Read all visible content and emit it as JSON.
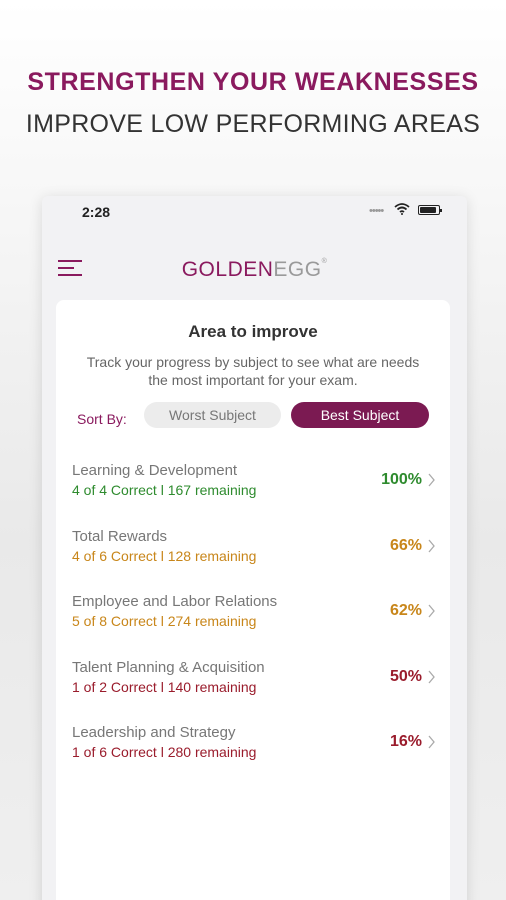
{
  "header": {
    "headline": "STRENGTHEN YOUR WEAKNESSES",
    "subheadline": "IMPROVE LOW PERFORMING AREAS"
  },
  "status_bar": {
    "time": "2:28"
  },
  "app": {
    "logo_golden": "GOLDEN",
    "logo_egg": "EGG",
    "logo_mark": "®"
  },
  "card": {
    "title": "Area to improve",
    "description": "Track your progress by subject to see what are needs the most important for your exam.",
    "sort_label": "Sort By:",
    "sort_worst": "Worst Subject",
    "sort_best": "Best Subject"
  },
  "subjects": [
    {
      "name": "Learning & Development",
      "stats": "4 of 4  Correct l 167 remaining",
      "percent": "100%",
      "color": "#2e8b2e"
    },
    {
      "name": "Total Rewards",
      "stats": "4 of 6  Correct l 128 remaining",
      "percent": "66%",
      "color": "#c8861a"
    },
    {
      "name": "Employee and Labor Relations",
      "stats": "5 of 8  Correct l 274 remaining",
      "percent": "62%",
      "color": "#c8861a"
    },
    {
      "name": "Talent Planning & Acquisition",
      "stats": "1 of 2  Correct l 140 remaining",
      "percent": "50%",
      "color": "#9a1c2c"
    },
    {
      "name": "Leadership and Strategy",
      "stats": "1 of 6  Correct l 280 remaining",
      "percent": "16%",
      "color": "#9a1c2c"
    }
  ],
  "colors": {
    "brand": "#8a1a5e",
    "active_button": "#7b1a52"
  }
}
